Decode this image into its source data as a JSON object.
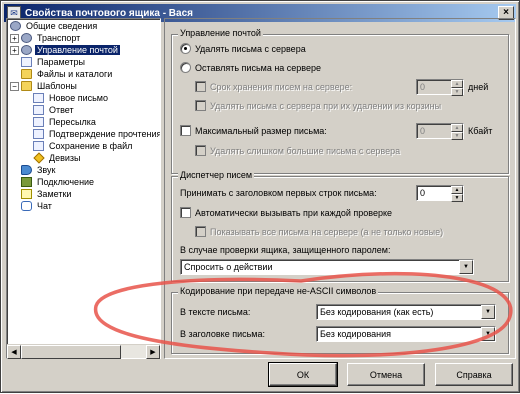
{
  "window": {
    "title": "Свойства почтового ящика - Вася",
    "close_glyph": "×"
  },
  "tree": {
    "items": [
      {
        "label": "Общие сведения",
        "icon": "gear-icon"
      },
      {
        "label": "Транспорт",
        "icon": "gear-icon"
      },
      {
        "label": "Управление почтой",
        "icon": "gear-icon"
      },
      {
        "label": "Параметры",
        "icon": "doc-icon"
      },
      {
        "label": "Файлы и каталоги",
        "icon": "folder-icon"
      },
      {
        "label": "Шаблоны",
        "icon": "folder-icon"
      },
      {
        "label": "Новое письмо",
        "icon": "doc-icon"
      },
      {
        "label": "Ответ",
        "icon": "doc-icon"
      },
      {
        "label": "Пересылка",
        "icon": "doc-icon"
      },
      {
        "label": "Подтверждение прочтения",
        "icon": "doc-icon"
      },
      {
        "label": "Сохранение в файл",
        "icon": "doc-icon"
      },
      {
        "label": "Девизы",
        "icon": "star-icon"
      },
      {
        "label": "Звук",
        "icon": "sound-icon"
      },
      {
        "label": "Подключение",
        "icon": "plug-icon"
      },
      {
        "label": "Заметки",
        "icon": "note-icon"
      },
      {
        "label": "Чат",
        "icon": "chat-icon"
      }
    ],
    "expander_plus": "+",
    "expander_minus": "−"
  },
  "mail": {
    "group_title": "Управление почтой",
    "delete_from_server": "Удалять письма с сервера",
    "keep_on_server": "Оставлять письма на сервере",
    "keep_period": "Срок хранения писем на сервере:",
    "keep_period_value": "0",
    "keep_period_unit": "дней",
    "delete_when_deleted": "Удалять письма с сервера при их удалении из корзины",
    "max_size": "Максимальный размер письма:",
    "max_size_value": "0",
    "max_size_unit": "Кбайт",
    "delete_too_big": "Удалять слишком большие письма с сервера"
  },
  "dispatcher": {
    "group_title": "Диспетчер писем",
    "accept_headers": "Принимать с заголовком первых строк письма:",
    "accept_headers_value": "0",
    "auto_call": "Автоматически вызывать при каждой проверке",
    "show_all": "Показывать все письма на сервере (а не только новые)",
    "password_label": "В случае проверки ящика, защищенного паролем:",
    "password_value": "Спросить о действии"
  },
  "encoding": {
    "group_title": "Кодирование при передаче не-ASCII символов",
    "body_label": "В тексте письма:",
    "body_value": "Без кодирования (как есть)",
    "header_label": "В заголовке письма:",
    "header_value": "Без кодирования"
  },
  "buttons": {
    "ok": "ОК",
    "cancel": "Отмена",
    "help": "Справка"
  },
  "colors": {
    "annotation": "#e8534a",
    "selection": "#0a246a"
  }
}
